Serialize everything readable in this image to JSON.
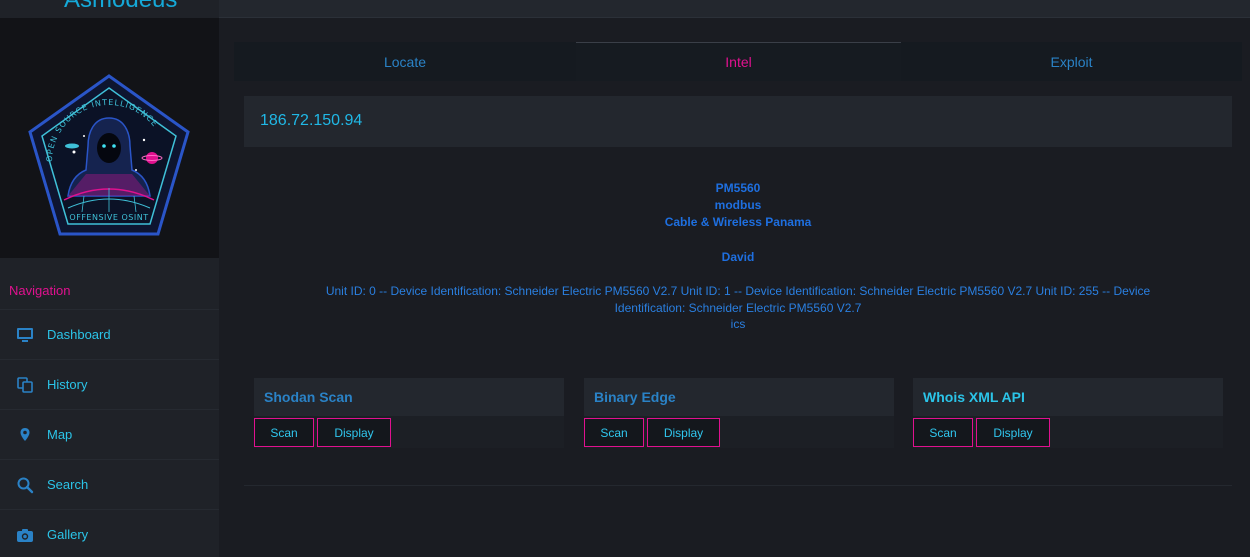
{
  "brand": {
    "title": "Asmodeus"
  },
  "logo": {
    "arc_text": "OPEN SOURCE INTELLIGENCE",
    "bottom_text": "OFFENSIVE OSINT"
  },
  "sidebar": {
    "heading": "Navigation",
    "items": [
      {
        "label": "Dashboard",
        "icon": "monitor-icon"
      },
      {
        "label": "History",
        "icon": "copy-icon"
      },
      {
        "label": "Map",
        "icon": "map-pin-icon"
      },
      {
        "label": "Search",
        "icon": "search-icon"
      },
      {
        "label": "Gallery",
        "icon": "camera-icon"
      }
    ]
  },
  "tabs": [
    {
      "label": "Locate",
      "active": false
    },
    {
      "label": "Intel",
      "active": true
    },
    {
      "label": "Exploit",
      "active": false
    }
  ],
  "target": {
    "ip": "186.72.150.94"
  },
  "intel": {
    "product": "PM5560",
    "protocol": "modbus",
    "isp": "Cable & Wireless Panama",
    "owner": "David",
    "banner": "Unit ID: 0 -- Device Identification: Schneider Electric PM5560 V2.7 Unit ID: 1 -- Device Identification: Schneider Electric PM5560 V2.7 Unit ID: 255 -- Device Identification: Schneider Electric PM5560 V2.7",
    "tags": "ics"
  },
  "panels": [
    {
      "title": "Shodan Scan",
      "title_color": "#2a82c6",
      "scan_label": "Scan",
      "display_label": "Display"
    },
    {
      "title": "Binary Edge",
      "title_color": "#2a82c6",
      "scan_label": "Scan",
      "display_label": "Display"
    },
    {
      "title": "Whois XML API",
      "title_color": "#2bc4e8",
      "scan_label": "Scan",
      "display_label": "Display"
    }
  ],
  "colors": {
    "accent_pink": "#e0118f",
    "accent_cyan": "#2bc4e8",
    "accent_blue": "#1e6fe0",
    "background": "#1a1c22"
  }
}
